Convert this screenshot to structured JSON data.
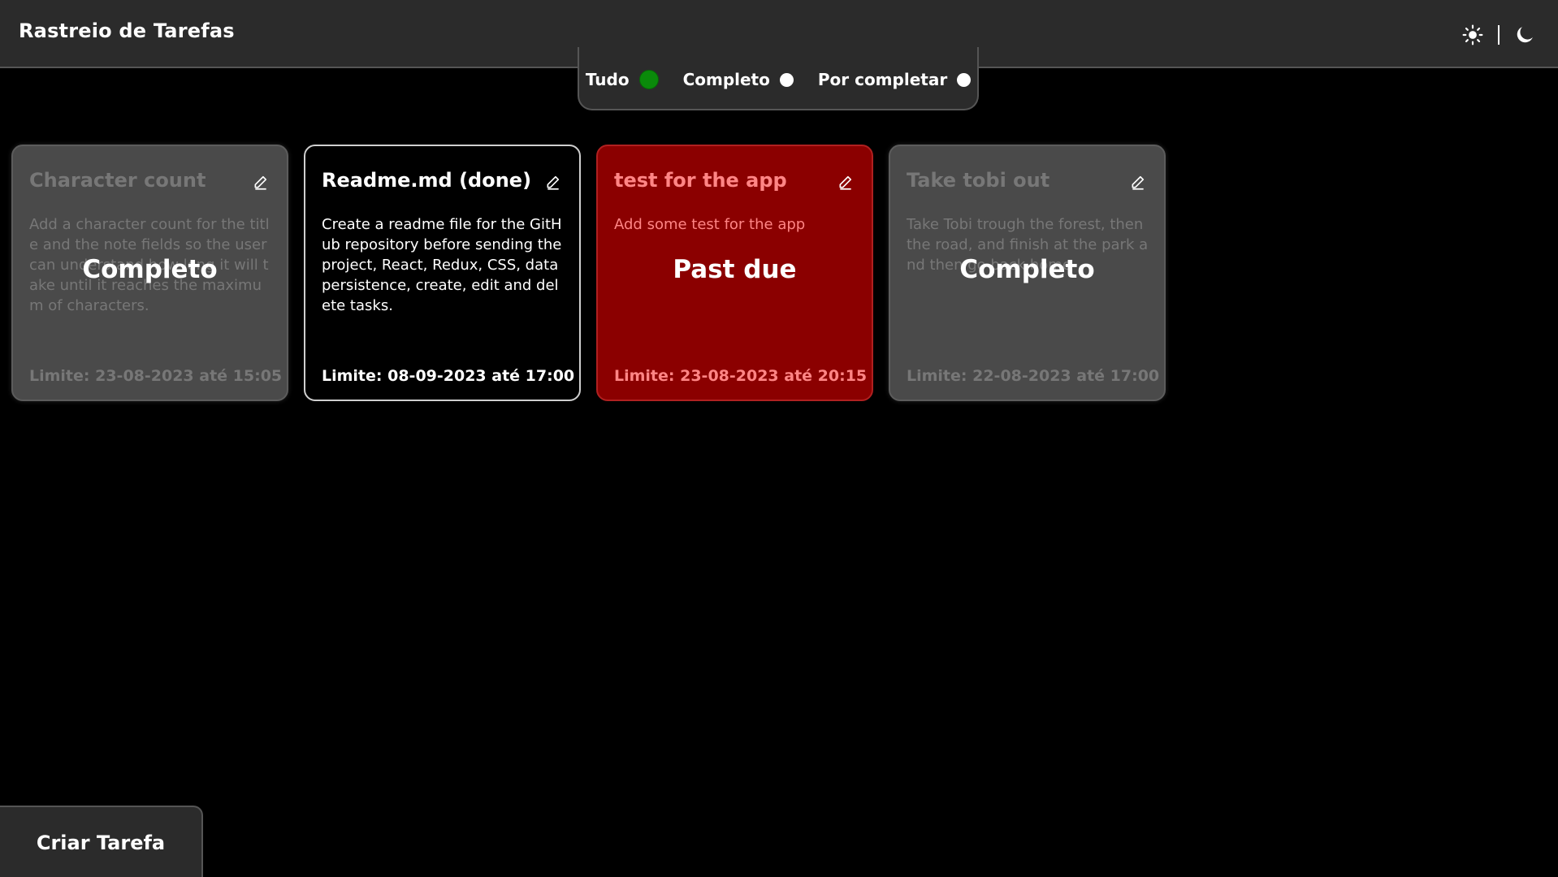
{
  "header": {
    "title": "Rastreio de Tarefas",
    "theme": {
      "light_icon": "sun-icon",
      "dark_icon": "moon-icon",
      "separator": "|"
    }
  },
  "filters": {
    "items": [
      {
        "label": "Tudo",
        "active": true
      },
      {
        "label": "Completo",
        "active": false
      },
      {
        "label": "Por completar",
        "active": false
      }
    ],
    "active_color": "#0a8a0a"
  },
  "tasks": [
    {
      "title": "Character count",
      "description": "Add a character count for the title and the note fields so the user can understand how long it will take until it reaches the maximum of characters.",
      "deadline": "Limite: 23-08-2023 até 15:05",
      "status": "Completo",
      "state": "done"
    },
    {
      "title": "Readme.md (done)",
      "description": "Create a readme file for the GitHub repository before sending the project, React, Redux, CSS, data persistence, create, edit and delete tasks.",
      "deadline": "Limite: 08-09-2023 até 17:00",
      "status": "",
      "state": "pending"
    },
    {
      "title": "test for the app",
      "description": "Add some test for the app",
      "deadline": "Limite: 23-08-2023 até 20:15",
      "status": "Past due",
      "state": "overdue"
    },
    {
      "title": "Take tobi out",
      "description": "Take Tobi trough the forest, then the road, and finish at the park and then go back home",
      "deadline": "Limite: 22-08-2023 até 17:00",
      "status": "Completo",
      "state": "done"
    }
  ],
  "colors": {
    "overdue_bg": "#8b0000",
    "done_bg": "#4a4a4a",
    "pending_bg": "#000000"
  },
  "create_button": {
    "label": "Criar Tarefa"
  }
}
